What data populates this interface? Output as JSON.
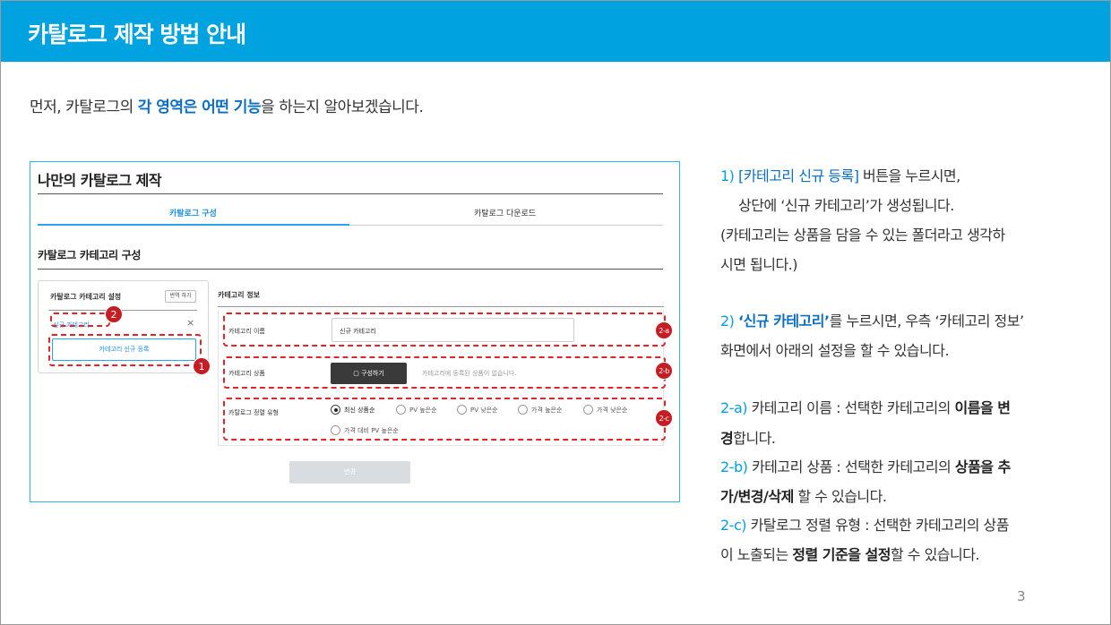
{
  "header": {
    "title": "카탈로그 제작 방법 안내"
  },
  "intro": {
    "before": "먼저, 카탈로그의 ",
    "highlight": "각 영역은 어떤 기능",
    "after": "을 하는지 알아보겠습니다."
  },
  "panel": {
    "title": "나만의 카탈로그 제작",
    "tabs": [
      "카탈로그 구성",
      "카탈로그 다운로드"
    ],
    "section_title": "카탈로그 카테고리 구성",
    "settings": {
      "title": "카탈로그 카테고리 설정",
      "translate_btn": "번역 하기",
      "new_category": "신규 카테고리",
      "close": "×",
      "register_btn": "카테고리 신규 등록"
    },
    "info": {
      "title": "카테고리 정보",
      "name_label": "카테고리 이름",
      "name_value": "신규 카테고리",
      "product_label": "카테고리 상품",
      "compose_btn": "구성하기",
      "empty_msg": "카테고리에 등록된 상품이 없습니다.",
      "sort_label": "카탈로그 정렬 유형",
      "sort_options": [
        "최신 상품순",
        "PV 높은순",
        "PV 낮은순",
        "가격 높은순",
        "가격 낮은순",
        "가격 대비 PV 높은순"
      ],
      "selected_index": 0
    },
    "save_btn": "변경",
    "badges": [
      "1",
      "2",
      "2-a",
      "2-b",
      "2-c"
    ]
  },
  "explain": {
    "p1_num": "1) ",
    "p1_hl": "[카테고리 신규 등록]",
    "p1_rest": " 버튼을 누르시면,",
    "p1_line2": "상단에 ‘신규 카테고리’가 생성됩니다.",
    "p1_line3": "(카테고리는 상품을 담을 수 있는 폴더라고 생각하",
    "p1_line4": "시면 됩니다.)",
    "p2_num": "2) ",
    "p2_hl": "‘신규 카테고리’",
    "p2_rest": "를 누르시면, 우측 ‘카테고리 정보’",
    "p2_line2": "화면에서 아래의 설정을 할 수 있습니다.",
    "a_tag": "2-a)",
    "a_text": " 카테고리 이름 : 선택한 카테고리의 ",
    "a_bold1": "이름을 변",
    "a_bold2": "경",
    "a_end": "합니다.",
    "b_tag": "2-b)",
    "b_text": " 카테고리 상품 : 선택한 카테고리의 ",
    "b_bold1": "상품을 추",
    "b_bold2": "가/변경/삭제",
    "b_end": " 할 수 있습니다.",
    "c_tag": "2-c)",
    "c_text": " 카탈로그 정렬 유형 : 선택한 카테고리의 상품",
    "c_line2a": "이 노출되는 ",
    "c_bold": "정렬 기준을 설정",
    "c_end": "할 수 있습니다."
  },
  "page_number": "3"
}
